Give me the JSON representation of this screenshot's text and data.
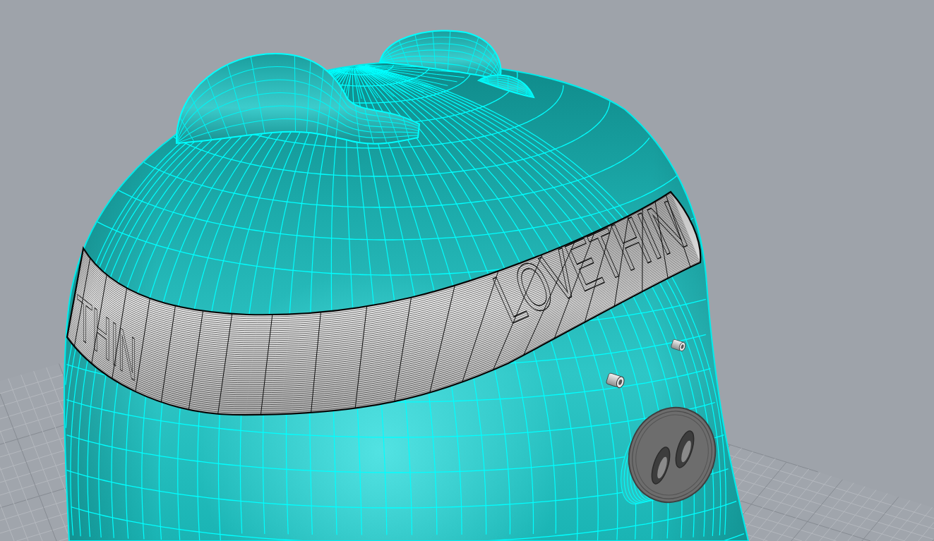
{
  "viewport": {
    "model": {
      "band_labels": [
        {
          "kind": "front",
          "text": "LOVETHIN"
        },
        {
          "kind": "side",
          "text": "THIN"
        }
      ]
    }
  }
}
